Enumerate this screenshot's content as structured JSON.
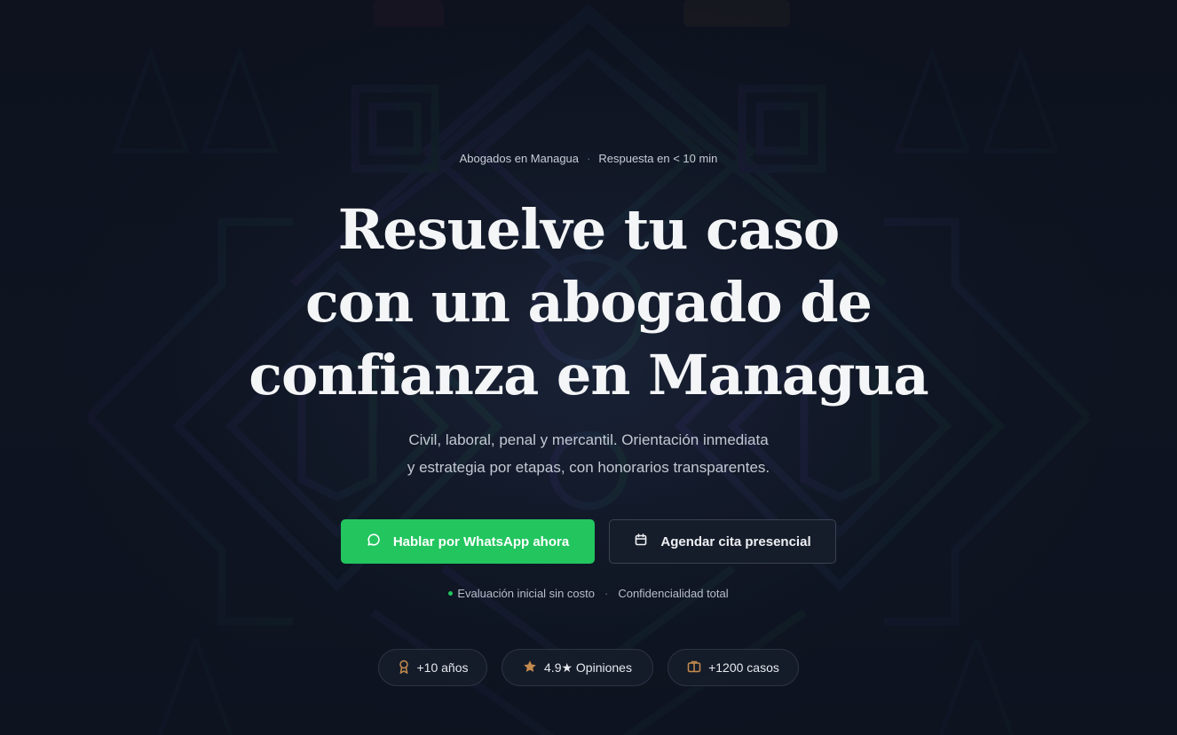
{
  "hero": {
    "eyebrow": {
      "location": "Abogados en Managua",
      "separator": "·",
      "response": "Respuesta en < 10 min"
    },
    "title_lines": [
      "Resuelve tu caso",
      "con un abogado de",
      "confianza en Managua"
    ],
    "subtitle_lines": [
      "Civil, laboral, penal y mercantil. Orientación inmediata",
      "y estrategia por etapas, con honorarios transparentes."
    ],
    "buttons": {
      "whatsapp": {
        "label": "Hablar por WhatsApp ahora",
        "icon": "chat-bubble-icon"
      },
      "cita": {
        "label": "Agendar cita presencial",
        "icon": "calendar-icon"
      }
    },
    "assurance": {
      "first": "Evaluación inicial sin costo",
      "separator": "·",
      "second": "Confidencialidad total"
    },
    "stats": [
      {
        "label": "+10 años",
        "icon": "award-icon"
      },
      {
        "label": "4.9★ Opiniones",
        "icon": "star-icon"
      },
      {
        "label": "+1200 casos",
        "icon": "briefcase-icon"
      }
    ]
  },
  "colors": {
    "background": "#0d1320",
    "accent_green": "#22c55e",
    "icon_gold": "#c58b4e",
    "title": "#f4f5f7"
  }
}
